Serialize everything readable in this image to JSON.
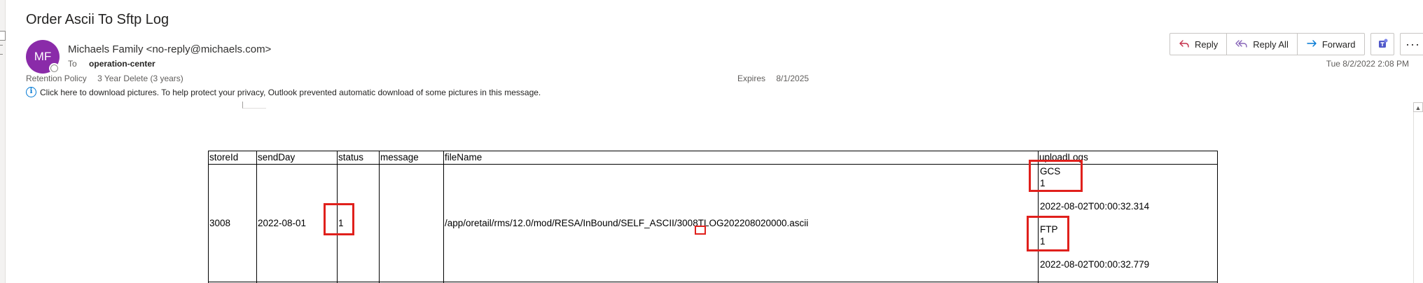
{
  "email": {
    "subject": "Order Ascii To Sftp Log",
    "sender_initials": "MF",
    "from": "Michaels Family <no-reply@michaels.com>",
    "to_label": "To",
    "to": "operation-center",
    "retention_label": "Retention Policy",
    "retention_value": "3 Year Delete (3 years)",
    "expires_label": "Expires",
    "expires_value": "8/1/2025",
    "info_message": "Click here to download pictures. To help protect your privacy, Outlook prevented automatic download of some pictures in this message.",
    "date": "Tue 8/2/2022 2:08 PM"
  },
  "actions": {
    "reply": "Reply",
    "reply_all": "Reply All",
    "forward": "Forward",
    "more": "···"
  },
  "log_table": {
    "headers": [
      "storeId",
      "sendDay",
      "status",
      "message",
      "fileName",
      "uploadLogs"
    ],
    "rows": [
      {
        "storeId": "3008",
        "sendDay": "2022-08-01",
        "status": "1",
        "message": "",
        "fileName": "/app/oretail/rms/12.0/mod/RESA/InBound/SELF_ASCII/3008TLOG202208020000.ascii",
        "uploadLogs": [
          {
            "target": "GCS",
            "status": "1",
            "time": "2022-08-02T00:00:32.314"
          },
          {
            "target": "FTP",
            "status": "1",
            "time": "2022-08-02T00:00:32.779"
          }
        ]
      }
    ]
  },
  "colors": {
    "avatar": "#8a2ba9",
    "highlight": "#e0201c",
    "info_icon": "#0078d4",
    "reply_icon": "#c4314b",
    "forward_icon": "#0078d4",
    "teams_icon": "#5059c9"
  },
  "icons": {
    "reply": "reply-arrow-icon",
    "reply_all": "reply-all-arrow-icon",
    "forward": "forward-arrow-icon",
    "teams": "teams-icon",
    "info": "info-circle-icon"
  }
}
